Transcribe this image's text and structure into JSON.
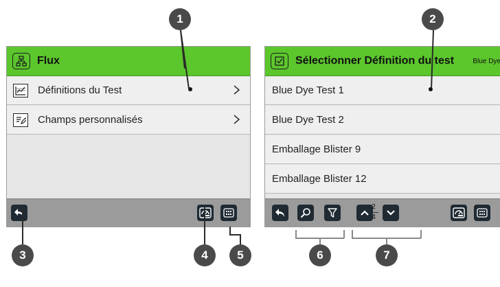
{
  "left_screen": {
    "header": {
      "title": "Flux",
      "icon": "flowchart-icon"
    },
    "rows": [
      {
        "label": "Définitions du Test",
        "icon": "chart-icon"
      },
      {
        "label": "Champs personnalisés",
        "icon": "edit-form-icon"
      }
    ],
    "toolbar": [
      "back-icon",
      "dashboard-icon",
      "grid-menu-icon"
    ]
  },
  "right_screen": {
    "header": {
      "title": "Sélectionner Définition du test",
      "right_text": "Blue Dye",
      "icon": "checkbox-icon"
    },
    "rows": [
      {
        "label": "Blue Dye Test 1"
      },
      {
        "label": "Blue Dye Test 2"
      },
      {
        "label": "Emballage Blister 9"
      },
      {
        "label": "Emballage Blister 12"
      }
    ],
    "toolbar": [
      "back-icon",
      "search-icon",
      "filter-icon",
      "page-up-icon",
      "page-down-icon",
      "dashboard-icon",
      "grid-menu-icon"
    ],
    "pager": {
      "current": "2",
      "total": "4"
    }
  },
  "callouts": [
    "1",
    "2",
    "3",
    "4",
    "5",
    "6",
    "7"
  ],
  "colors": {
    "header_green": "#5cc62d",
    "button_dark": "#1f2a33",
    "callout_gray": "#4a4a4a",
    "toolbar_gray": "#9b9b9b"
  }
}
